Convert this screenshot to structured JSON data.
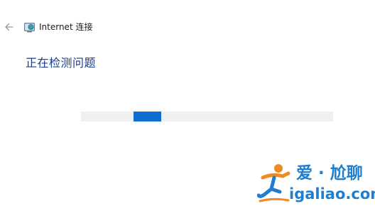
{
  "window": {
    "title": "Internet 连接",
    "back_icon": "back-arrow-icon",
    "app_icon": "network-globe-icon"
  },
  "main": {
    "heading": "正在检测问题"
  },
  "progress": {
    "mode": "indeterminate"
  },
  "watermark": {
    "title": "爱 · 尬聊",
    "url": "igaliao.com",
    "logo": "running-figure-logo"
  },
  "colors": {
    "heading": "#1a3d8a",
    "accent": "#0a6fcf",
    "track": "#efefef",
    "watermark_blue": "#1e7fd0",
    "watermark_orange": "#f08a24"
  }
}
